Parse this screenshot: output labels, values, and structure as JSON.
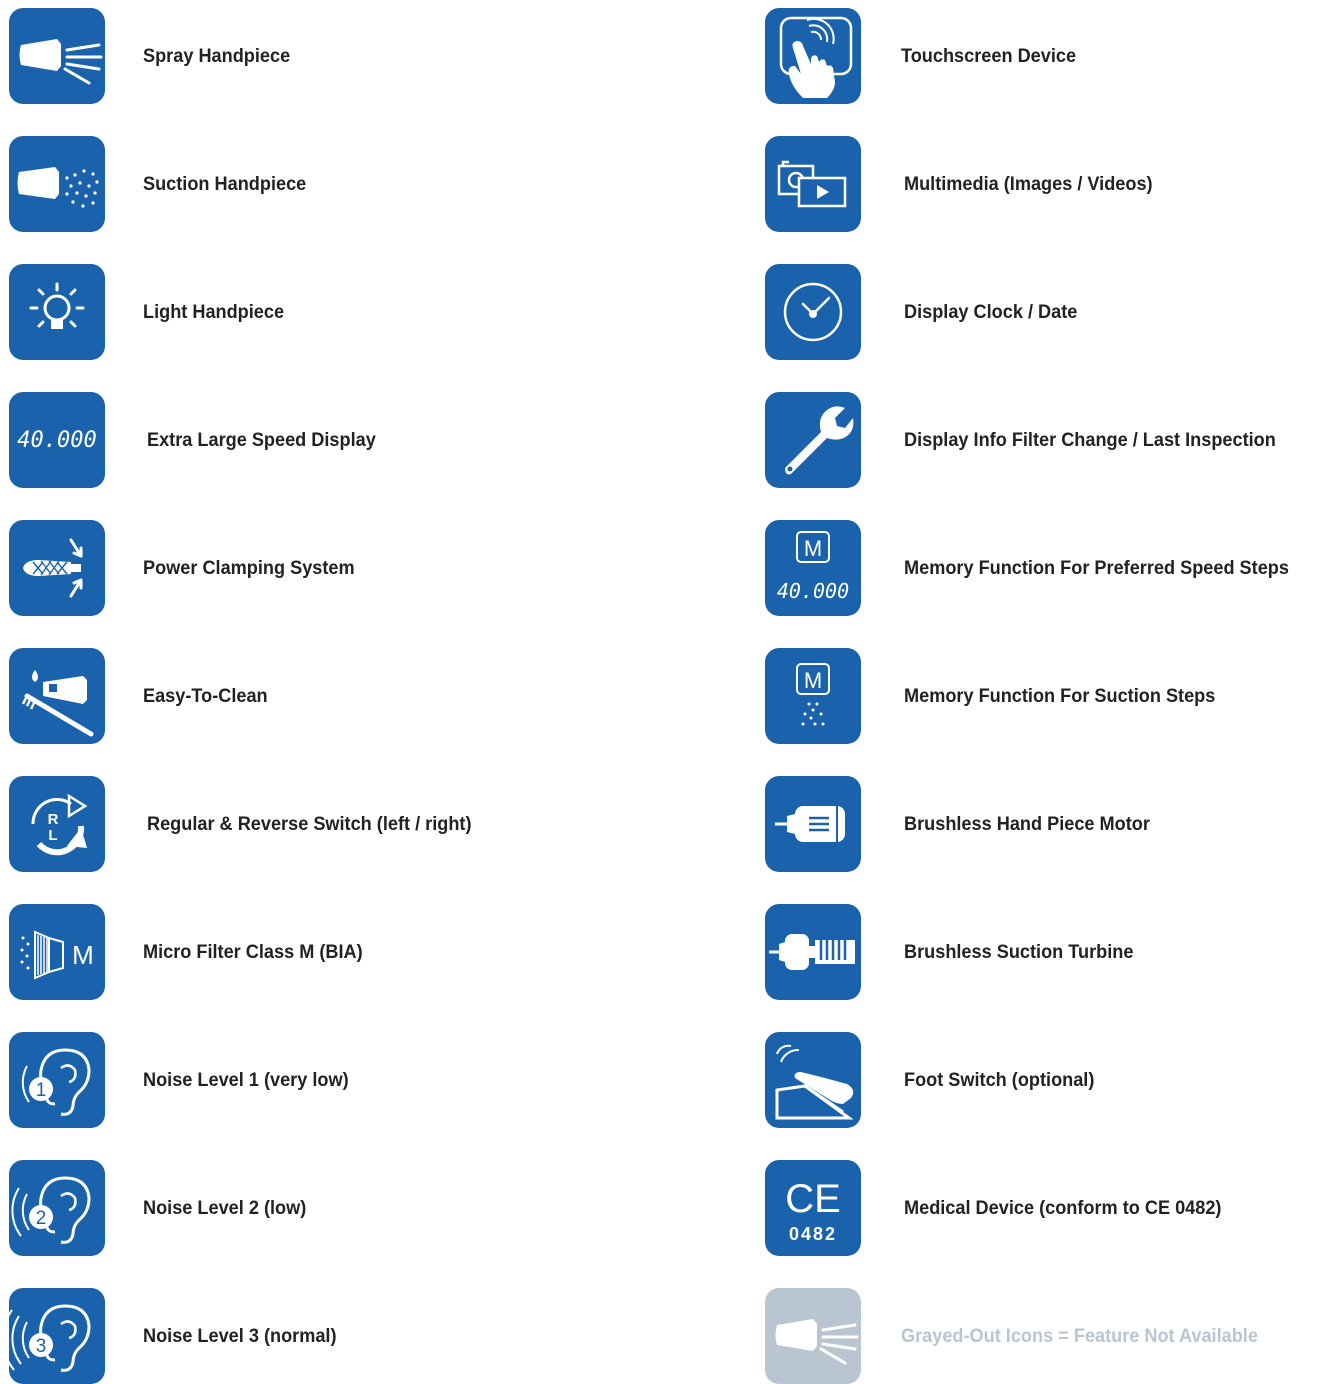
{
  "left_column": [
    {
      "icon": "spray-handpiece-icon",
      "label": "Spray Handpiece"
    },
    {
      "icon": "suction-handpiece-icon",
      "label": "Suction Handpiece"
    },
    {
      "icon": "light-bulb-icon",
      "label": "Light Handpiece"
    },
    {
      "icon": "speed-display-icon",
      "icon_text": "40.000",
      "label": "Extra Large Speed Display"
    },
    {
      "icon": "clamping-icon",
      "label": "Power Clamping System"
    },
    {
      "icon": "easy-clean-icon",
      "label": "Easy-To-Clean"
    },
    {
      "icon": "reverse-switch-icon",
      "icon_text_top": "R",
      "icon_text_bottom": "L",
      "label": "Regular & Reverse Switch (left / right)"
    },
    {
      "icon": "micro-filter-icon",
      "icon_text": "M",
      "label": "Micro Filter Class M (BIA)"
    },
    {
      "icon": "ear-icon",
      "icon_text": "1",
      "label": "Noise Level 1 (very low)"
    },
    {
      "icon": "ear-icon",
      "icon_text": "2",
      "label": "Noise Level  2 (low)"
    },
    {
      "icon": "ear-icon",
      "icon_text": "3",
      "label": "Noise Level  3 (normal)"
    }
  ],
  "right_column": [
    {
      "icon": "touchscreen-icon",
      "label": "Touchscreen Device"
    },
    {
      "icon": "multimedia-icon",
      "label": "Multimedia (Images / Videos)"
    },
    {
      "icon": "clock-icon",
      "label": "Display Clock / Date"
    },
    {
      "icon": "wrench-icon",
      "label": "Display Info Filter Change / Last Inspection"
    },
    {
      "icon": "memory-speed-icon",
      "icon_text_top": "M",
      "icon_text_bottom": "40.000",
      "label": "Memory Function For Preferred Speed Steps"
    },
    {
      "icon": "memory-suction-icon",
      "icon_text": "M",
      "label": "Memory Function For Suction Steps"
    },
    {
      "icon": "motor-icon",
      "label": "Brushless Hand Piece Motor"
    },
    {
      "icon": "turbine-icon",
      "label": "Brushless Suction Turbine"
    },
    {
      "icon": "foot-switch-icon",
      "label": "Foot Switch (optional)"
    },
    {
      "icon": "ce-mark-icon",
      "icon_text_top": "CE",
      "icon_text_bottom": "0482",
      "label": "Medical Device (conform to CE 0482)"
    },
    {
      "icon": "spray-handpiece-icon",
      "label": "Grayed-Out Icons = Feature Not Available"
    }
  ],
  "colors": {
    "tile": "#1a63ac",
    "tile_disabled": "#b9c6d2",
    "label": "#222222",
    "label_disabled": "#b9c6d2"
  }
}
